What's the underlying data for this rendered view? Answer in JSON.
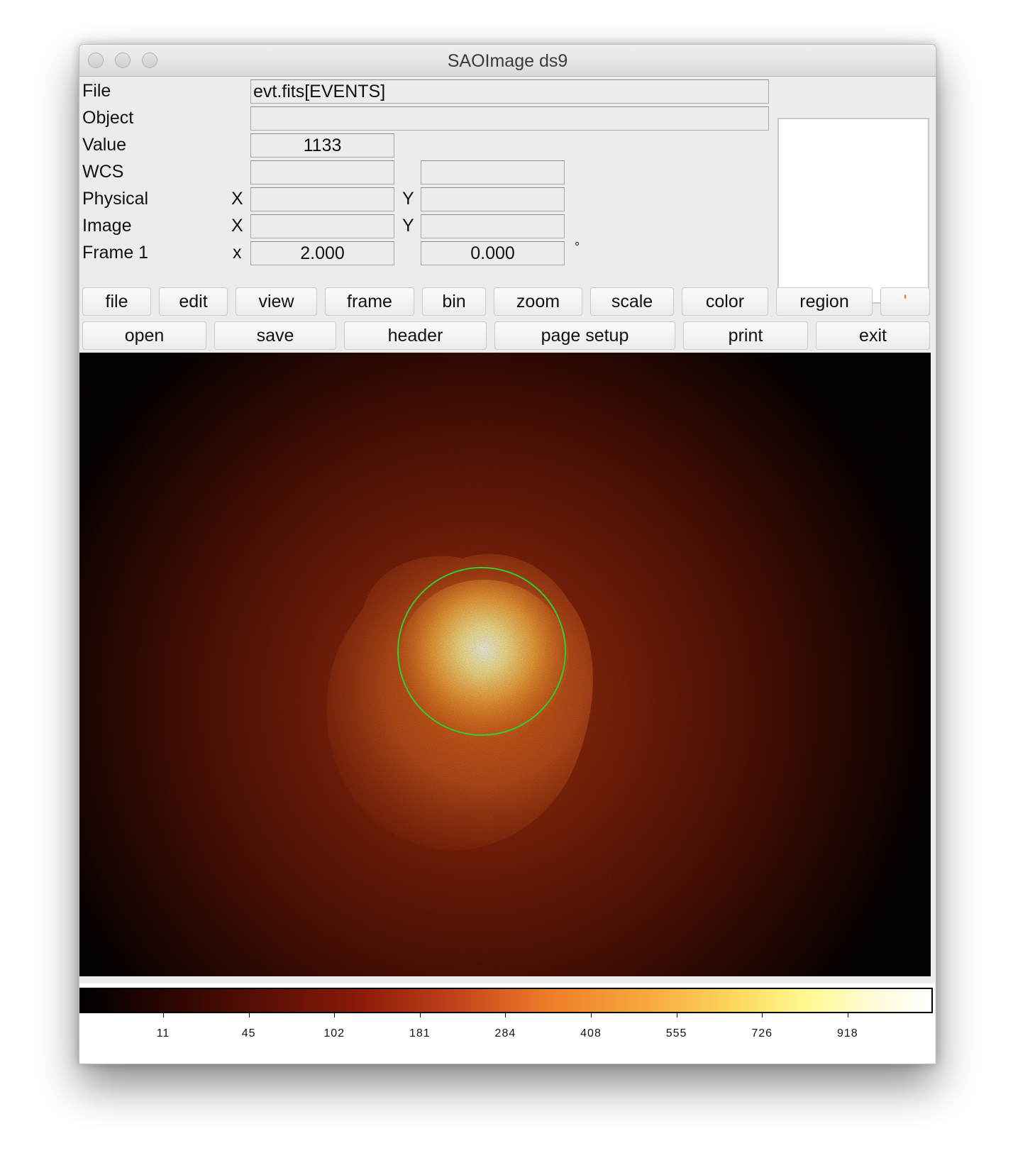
{
  "window": {
    "title": "SAOImage ds9"
  },
  "info_panel": {
    "labels": {
      "file": "File",
      "object": "Object",
      "value": "Value",
      "wcs": "WCS",
      "physical": "Physical",
      "image": "Image",
      "frame": "Frame 1"
    },
    "axis": {
      "physical_x": "X",
      "physical_y": "Y",
      "image_x": "X",
      "image_y": "Y",
      "frame_x": "x"
    },
    "file_value": "evt.fits[EVENTS]",
    "object_value": "",
    "pixel_value": "1133",
    "wcs_x": "",
    "wcs_y": "",
    "physical_x": "",
    "physical_y": "",
    "image_x": "",
    "image_y": "",
    "frame_zoom": "2.000",
    "frame_angle": "0.000",
    "degree_symbol": "°"
  },
  "menu_bar": {
    "items": [
      "file",
      "edit",
      "view",
      "frame",
      "bin",
      "zoom",
      "scale",
      "color",
      "region"
    ],
    "overflow": "'"
  },
  "button_bar": {
    "items": [
      "open",
      "save",
      "header",
      "page setup",
      "print",
      "exit"
    ]
  },
  "image": {
    "colormap": "heat",
    "region": {
      "shape": "circle",
      "color": "#33cc33"
    }
  },
  "colorbar": {
    "colormap": "heat",
    "ticks": [
      "11",
      "45",
      "102",
      "181",
      "284",
      "408",
      "555",
      "726",
      "918"
    ]
  }
}
